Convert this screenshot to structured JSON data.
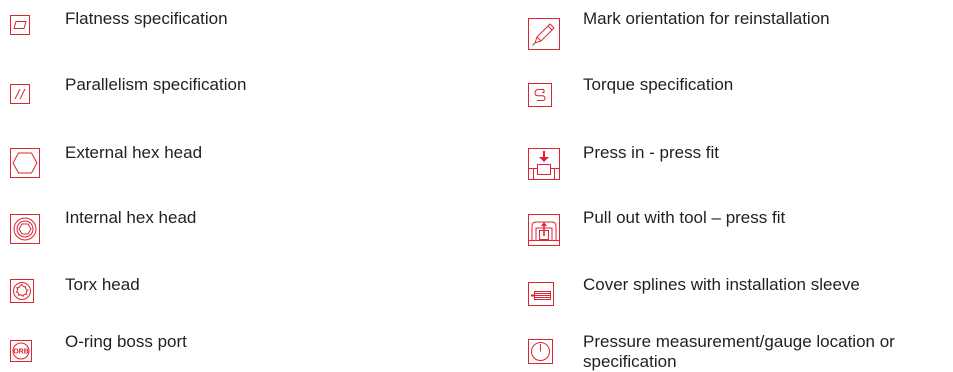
{
  "colors": {
    "icon_red": "#d92630",
    "text": "#231f20",
    "background": "#ffffff"
  },
  "left_column": [
    {
      "icon": "flatness-icon",
      "label": "Flatness specification"
    },
    {
      "icon": "parallelism-icon",
      "label": "Parallelism specification"
    },
    {
      "icon": "external-hex-head-icon",
      "label": "External hex head"
    },
    {
      "icon": "internal-hex-head-icon",
      "label": "Internal hex head"
    },
    {
      "icon": "torx-head-icon",
      "label": "Torx head"
    },
    {
      "icon": "o-ring-boss-port-icon",
      "label": "O-ring boss port",
      "icon_text": "ORB"
    }
  ],
  "right_column": [
    {
      "icon": "pencil-mark-icon",
      "label": "Mark orientation for reinstallation"
    },
    {
      "icon": "torque-wrench-icon",
      "label": "Torque specification"
    },
    {
      "icon": "press-in-icon",
      "label": "Press in - press fit"
    },
    {
      "icon": "pull-out-tool-icon",
      "label": "Pull out with tool – press fit"
    },
    {
      "icon": "installation-sleeve-icon",
      "label": "Cover splines with installation sleeve"
    },
    {
      "icon": "pressure-gauge-icon",
      "label": "Pressure measurement/gauge location or specification"
    }
  ]
}
